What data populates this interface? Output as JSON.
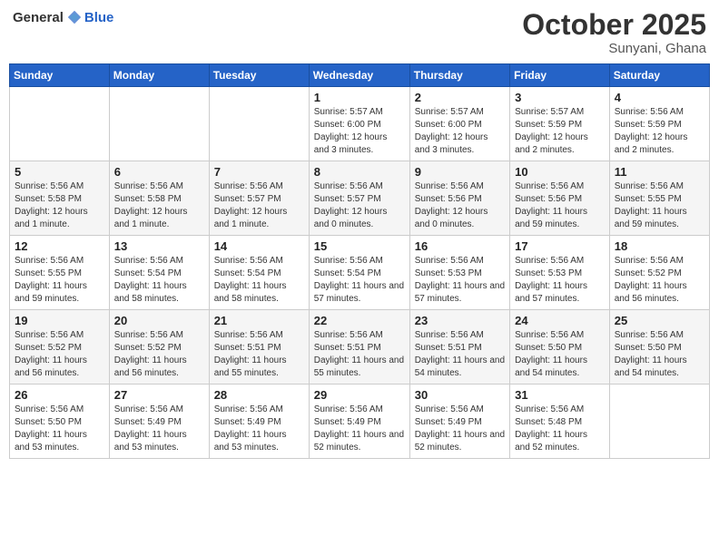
{
  "header": {
    "logo_general": "General",
    "logo_blue": "Blue",
    "month": "October 2025",
    "location": "Sunyani, Ghana"
  },
  "days_of_week": [
    "Sunday",
    "Monday",
    "Tuesday",
    "Wednesday",
    "Thursday",
    "Friday",
    "Saturday"
  ],
  "weeks": [
    [
      {
        "day": "",
        "sunrise": "",
        "sunset": "",
        "daylight": ""
      },
      {
        "day": "",
        "sunrise": "",
        "sunset": "",
        "daylight": ""
      },
      {
        "day": "",
        "sunrise": "",
        "sunset": "",
        "daylight": ""
      },
      {
        "day": "1",
        "sunrise": "Sunrise: 5:57 AM",
        "sunset": "Sunset: 6:00 PM",
        "daylight": "Daylight: 12 hours and 3 minutes."
      },
      {
        "day": "2",
        "sunrise": "Sunrise: 5:57 AM",
        "sunset": "Sunset: 6:00 PM",
        "daylight": "Daylight: 12 hours and 3 minutes."
      },
      {
        "day": "3",
        "sunrise": "Sunrise: 5:57 AM",
        "sunset": "Sunset: 5:59 PM",
        "daylight": "Daylight: 12 hours and 2 minutes."
      },
      {
        "day": "4",
        "sunrise": "Sunrise: 5:56 AM",
        "sunset": "Sunset: 5:59 PM",
        "daylight": "Daylight: 12 hours and 2 minutes."
      }
    ],
    [
      {
        "day": "5",
        "sunrise": "Sunrise: 5:56 AM",
        "sunset": "Sunset: 5:58 PM",
        "daylight": "Daylight: 12 hours and 1 minute."
      },
      {
        "day": "6",
        "sunrise": "Sunrise: 5:56 AM",
        "sunset": "Sunset: 5:58 PM",
        "daylight": "Daylight: 12 hours and 1 minute."
      },
      {
        "day": "7",
        "sunrise": "Sunrise: 5:56 AM",
        "sunset": "Sunset: 5:57 PM",
        "daylight": "Daylight: 12 hours and 1 minute."
      },
      {
        "day": "8",
        "sunrise": "Sunrise: 5:56 AM",
        "sunset": "Sunset: 5:57 PM",
        "daylight": "Daylight: 12 hours and 0 minutes."
      },
      {
        "day": "9",
        "sunrise": "Sunrise: 5:56 AM",
        "sunset": "Sunset: 5:56 PM",
        "daylight": "Daylight: 12 hours and 0 minutes."
      },
      {
        "day": "10",
        "sunrise": "Sunrise: 5:56 AM",
        "sunset": "Sunset: 5:56 PM",
        "daylight": "Daylight: 11 hours and 59 minutes."
      },
      {
        "day": "11",
        "sunrise": "Sunrise: 5:56 AM",
        "sunset": "Sunset: 5:55 PM",
        "daylight": "Daylight: 11 hours and 59 minutes."
      }
    ],
    [
      {
        "day": "12",
        "sunrise": "Sunrise: 5:56 AM",
        "sunset": "Sunset: 5:55 PM",
        "daylight": "Daylight: 11 hours and 59 minutes."
      },
      {
        "day": "13",
        "sunrise": "Sunrise: 5:56 AM",
        "sunset": "Sunset: 5:54 PM",
        "daylight": "Daylight: 11 hours and 58 minutes."
      },
      {
        "day": "14",
        "sunrise": "Sunrise: 5:56 AM",
        "sunset": "Sunset: 5:54 PM",
        "daylight": "Daylight: 11 hours and 58 minutes."
      },
      {
        "day": "15",
        "sunrise": "Sunrise: 5:56 AM",
        "sunset": "Sunset: 5:54 PM",
        "daylight": "Daylight: 11 hours and 57 minutes."
      },
      {
        "day": "16",
        "sunrise": "Sunrise: 5:56 AM",
        "sunset": "Sunset: 5:53 PM",
        "daylight": "Daylight: 11 hours and 57 minutes."
      },
      {
        "day": "17",
        "sunrise": "Sunrise: 5:56 AM",
        "sunset": "Sunset: 5:53 PM",
        "daylight": "Daylight: 11 hours and 57 minutes."
      },
      {
        "day": "18",
        "sunrise": "Sunrise: 5:56 AM",
        "sunset": "Sunset: 5:52 PM",
        "daylight": "Daylight: 11 hours and 56 minutes."
      }
    ],
    [
      {
        "day": "19",
        "sunrise": "Sunrise: 5:56 AM",
        "sunset": "Sunset: 5:52 PM",
        "daylight": "Daylight: 11 hours and 56 minutes."
      },
      {
        "day": "20",
        "sunrise": "Sunrise: 5:56 AM",
        "sunset": "Sunset: 5:52 PM",
        "daylight": "Daylight: 11 hours and 56 minutes."
      },
      {
        "day": "21",
        "sunrise": "Sunrise: 5:56 AM",
        "sunset": "Sunset: 5:51 PM",
        "daylight": "Daylight: 11 hours and 55 minutes."
      },
      {
        "day": "22",
        "sunrise": "Sunrise: 5:56 AM",
        "sunset": "Sunset: 5:51 PM",
        "daylight": "Daylight: 11 hours and 55 minutes."
      },
      {
        "day": "23",
        "sunrise": "Sunrise: 5:56 AM",
        "sunset": "Sunset: 5:51 PM",
        "daylight": "Daylight: 11 hours and 54 minutes."
      },
      {
        "day": "24",
        "sunrise": "Sunrise: 5:56 AM",
        "sunset": "Sunset: 5:50 PM",
        "daylight": "Daylight: 11 hours and 54 minutes."
      },
      {
        "day": "25",
        "sunrise": "Sunrise: 5:56 AM",
        "sunset": "Sunset: 5:50 PM",
        "daylight": "Daylight: 11 hours and 54 minutes."
      }
    ],
    [
      {
        "day": "26",
        "sunrise": "Sunrise: 5:56 AM",
        "sunset": "Sunset: 5:50 PM",
        "daylight": "Daylight: 11 hours and 53 minutes."
      },
      {
        "day": "27",
        "sunrise": "Sunrise: 5:56 AM",
        "sunset": "Sunset: 5:49 PM",
        "daylight": "Daylight: 11 hours and 53 minutes."
      },
      {
        "day": "28",
        "sunrise": "Sunrise: 5:56 AM",
        "sunset": "Sunset: 5:49 PM",
        "daylight": "Daylight: 11 hours and 53 minutes."
      },
      {
        "day": "29",
        "sunrise": "Sunrise: 5:56 AM",
        "sunset": "Sunset: 5:49 PM",
        "daylight": "Daylight: 11 hours and 52 minutes."
      },
      {
        "day": "30",
        "sunrise": "Sunrise: 5:56 AM",
        "sunset": "Sunset: 5:49 PM",
        "daylight": "Daylight: 11 hours and 52 minutes."
      },
      {
        "day": "31",
        "sunrise": "Sunrise: 5:56 AM",
        "sunset": "Sunset: 5:48 PM",
        "daylight": "Daylight: 11 hours and 52 minutes."
      },
      {
        "day": "",
        "sunrise": "",
        "sunset": "",
        "daylight": ""
      }
    ]
  ]
}
